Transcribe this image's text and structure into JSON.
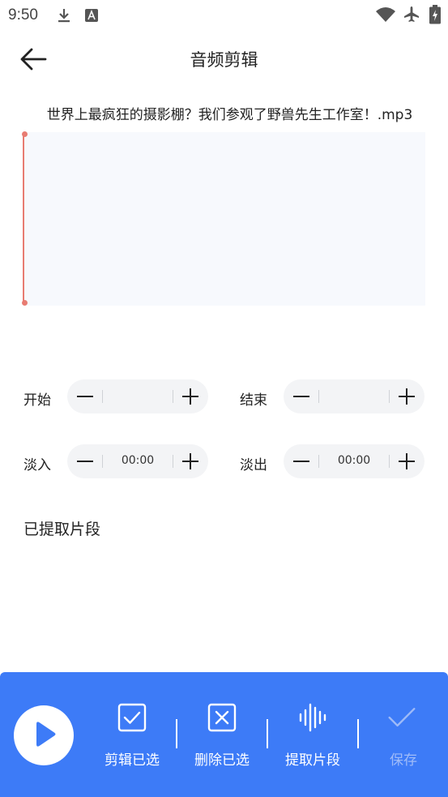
{
  "status_bar": {
    "time": "9:50",
    "icons": [
      "download-icon",
      "a-icon",
      "wifi-icon",
      "airplane-icon",
      "battery-icon"
    ]
  },
  "header": {
    "title": "音频剪辑",
    "back_icon": "arrow-left-icon"
  },
  "file": {
    "name": "世界上最疯狂的摄影棚？我们参观了野兽先生工作室！.mp3"
  },
  "controls": {
    "start": {
      "label": "开始",
      "value": ""
    },
    "end": {
      "label": "结束",
      "value": ""
    },
    "fade_in": {
      "label": "淡入",
      "value": "00:00"
    },
    "fade_out": {
      "label": "淡出",
      "value": "00:00"
    }
  },
  "extracted": {
    "title": "已提取片段"
  },
  "bottom_bar": {
    "actions": [
      {
        "label": "剪辑已选",
        "icon": "checkbox-icon"
      },
      {
        "label": "删除已选",
        "icon": "delete-box-icon"
      },
      {
        "label": "提取片段",
        "icon": "waveform-icon"
      },
      {
        "label": "保存",
        "icon": "check-icon"
      }
    ]
  },
  "colors": {
    "accent": "#3d7bf7",
    "cursor": "#e87c72",
    "waveform_bg": "#f7f9fd"
  }
}
